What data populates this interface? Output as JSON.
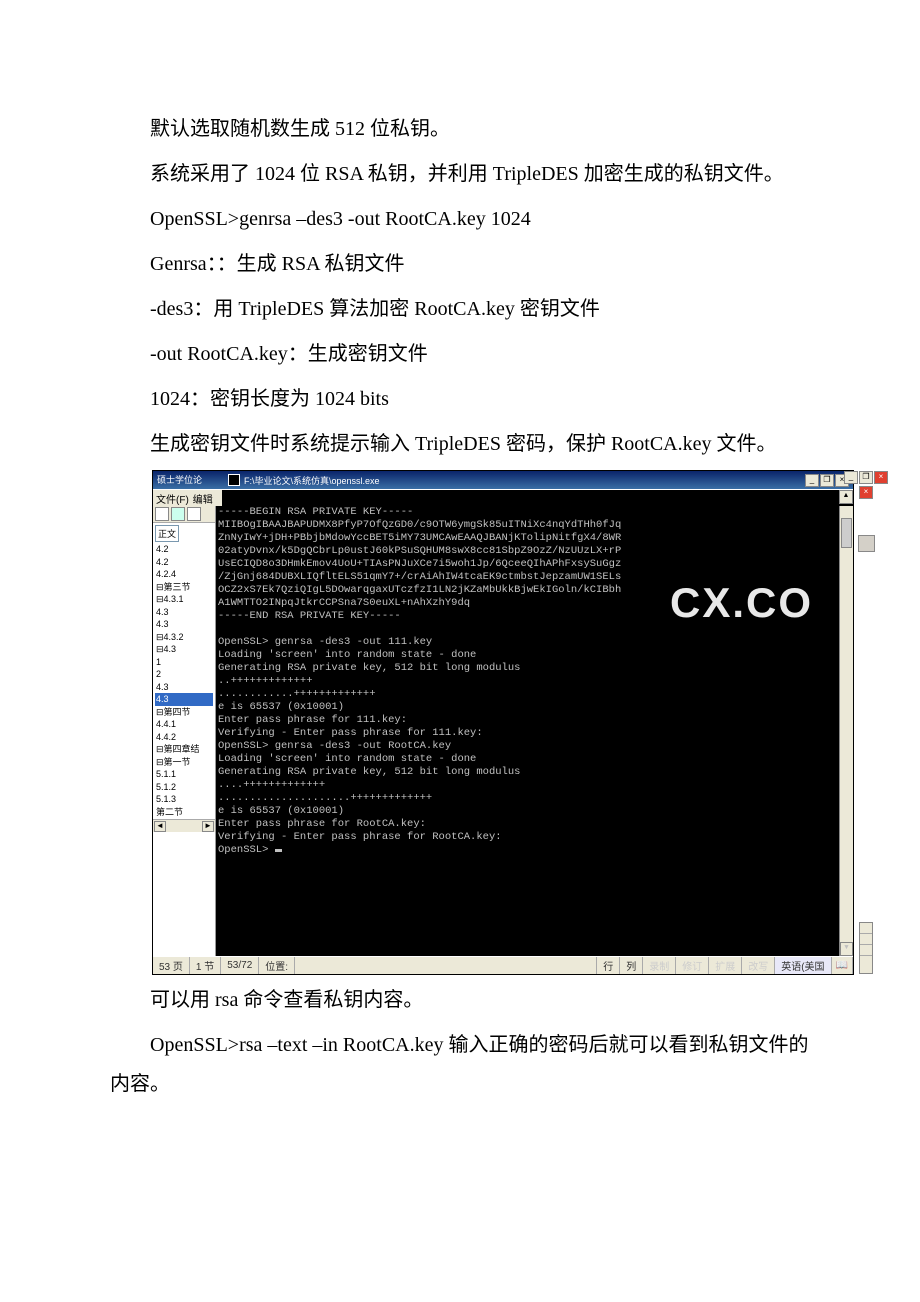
{
  "paragraphs": {
    "p1": "默认选取随机数生成 512 位私钥。",
    "p2": "系统采用了 1024 位 RSA 私钥，并利用 TripleDES 加密生成的私钥文件。",
    "p3": "OpenSSL>genrsa –des3 -out RootCA.key 1024",
    "p4": "Genrsa：：生成 RSA 私钥文件",
    "p5": "-des3：用 TripleDES 算法加密 RootCA.key 密钥文件",
    "p6": " -out RootCA.key：生成密钥文件",
    "p7": "1024：密钥长度为 1024 bits",
    "p8": "生成密钥文件时系统提示输入 TripleDES 密码，保护 RootCA.key 文件。",
    "p9": "可以用 rsa 命令查看私钥内容。",
    "p10": "OpenSSL>rsa –text –in RootCA.key 输入正确的密码后就可以看到私钥文件的内容。"
  },
  "screenshot": {
    "outer_title": "硕士学位论",
    "console_title": "F:\\毕业论文\\系统仿真\\openssl.exe",
    "menu": {
      "file": "文件(F)",
      "edit": "编辑"
    },
    "toolbar_label": "正文",
    "outline": [
      "4.2",
      "4.2",
      "4.2.4",
      "⊟第三节",
      "⊟4.3.1",
      "4.3",
      "4.3",
      "⊟4.3.2",
      "⊟4.3",
      "1",
      "2",
      "4.3",
      "4.3",
      "⊟第四节",
      "4.4.1",
      "4.4.2",
      "⊟第四章结",
      "⊟第一节",
      "5.1.1",
      "5.1.2",
      "5.1.3",
      "第二节"
    ],
    "outline_selected_index": 12,
    "console_lines": [
      "-----BEGIN RSA PRIVATE KEY-----",
      "MIIBOgIBAAJBAPUDMX8PfyP7OfQzGD0/c9OTW6ymgSk85uITNiXc4nqYdTHh0fJq",
      "ZnNyIwY+jDH+PBbjbMdowYccBET5iMY73UMCAwEAAQJBANjKTolipNitfgX4/8WR",
      "02atyDvnx/k5DgQCbrLp0ustJ60kPSuSQHUM8swX8cc81SbpZ9OzZ/NzUUzLX+rP",
      "UsECIQD8o3DHmkEmov4UoU+TIAsPNJuXCe7i5woh1Jp/6QceeQIhAPhFxsySuGgz",
      "/ZjGnj684DUBXLIQfltELS51qmY7+/crAiAhIW4tcaEK9ctmbstJepzamUW1SELs",
      "OCZ2xS7Ek7QziQIgL5DOwarqgaxUTczfzI1LN2jKZaMbUkkBjwEkIGoln/kCIBbh",
      "A1WMTTO2INpqJtkrCCPSna7S0euXL+nAhXzhY9dq",
      "-----END RSA PRIVATE KEY-----",
      "",
      "OpenSSL> genrsa -des3 -out 111.key",
      "Loading 'screen' into random state - done",
      "Generating RSA private key, 512 bit long modulus",
      "..+++++++++++++",
      "............+++++++++++++",
      "e is 65537 (0x10001)",
      "Enter pass phrase for 111.key:",
      "Verifying - Enter pass phrase for 111.key:",
      "OpenSSL> genrsa -des3 -out RootCA.key",
      "Loading 'screen' into random state - done",
      "Generating RSA private key, 512 bit long modulus",
      "....+++++++++++++",
      ".....................+++++++++++++",
      "e is 65537 (0x10001)",
      "Enter pass phrase for RootCA.key:",
      "Verifying - Enter pass phrase for RootCA.key:",
      "OpenSSL> "
    ],
    "watermark": "CX.CO",
    "statusbar": {
      "page": "53 页",
      "sec": "1 节",
      "pos": "53/72",
      "loc": "位置:",
      "row": "行",
      "col": "列",
      "rec": "录制",
      "rev": "修订",
      "ext": "扩展",
      "ovr": "改写",
      "lang": "英语(美国"
    },
    "winbtn": {
      "min": "_",
      "max": "□",
      "close": "×",
      "restore": "❐"
    },
    "arrows": {
      "up": "▲",
      "down": "▼",
      "left": "◄",
      "right": "►"
    }
  }
}
